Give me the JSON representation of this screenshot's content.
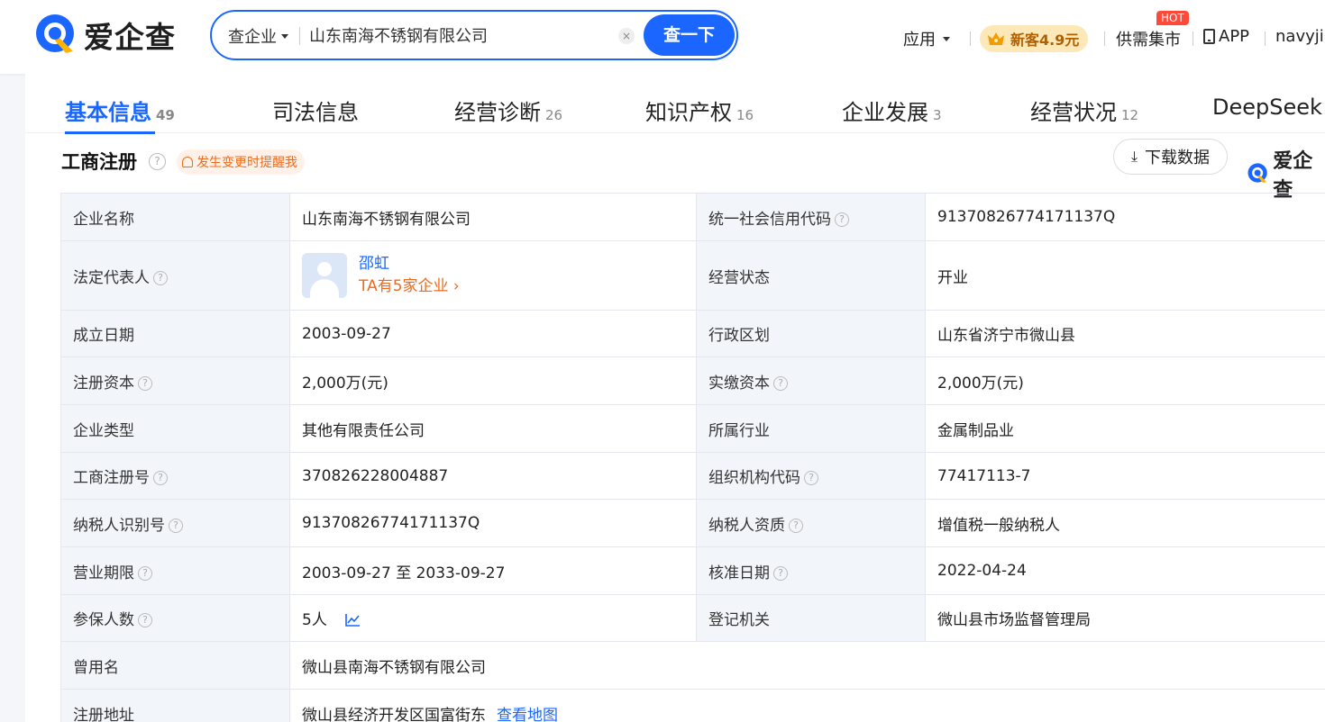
{
  "header": {
    "logo_text": "爱企查",
    "search_type": "查企业",
    "search_value": "山东南海不锈钢有限公司",
    "clear_label": "×",
    "search_button": "查一下",
    "apps_label": "应用",
    "promo_label": "新客4.9元",
    "market_label": "供需集市",
    "hot_badge": "HOT",
    "app_label": "APP",
    "user_label": "navyjia"
  },
  "tabs": [
    {
      "label": "基本信息",
      "count": "49",
      "active": true
    },
    {
      "label": "司法信息",
      "count": ""
    },
    {
      "label": "经营诊断",
      "count": "26"
    },
    {
      "label": "知识产权",
      "count": "16"
    },
    {
      "label": "企业发展",
      "count": "3"
    },
    {
      "label": "经营状况",
      "count": "12"
    },
    {
      "label": "DeepSeek",
      "count": ""
    }
  ],
  "section": {
    "title": "工商注册",
    "help": "?",
    "remind_label": "发生变更时提醒我",
    "download_label": "下载数据",
    "logo_text": "爱企查"
  },
  "table": {
    "company_name_label": "企业名称",
    "company_name": "山东南海不锈钢有限公司",
    "credit_code_label": "统一社会信用代码",
    "credit_code": "91370826774171137Q",
    "legal_rep_label": "法定代表人",
    "legal_rep_name": "邵虹",
    "legal_rep_link": "TA有5家企业 ›",
    "status_label": "经营状态",
    "status": "开业",
    "founded_label": "成立日期",
    "founded": "2003-09-27",
    "region_label": "行政区划",
    "region": "山东省济宁市微山县",
    "reg_capital_label": "注册资本",
    "reg_capital": "2,000万(元)",
    "paid_capital_label": "实缴资本",
    "paid_capital": "2,000万(元)",
    "type_label": "企业类型",
    "type": "其他有限责任公司",
    "industry_label": "所属行业",
    "industry": "金属制品业",
    "reg_no_label": "工商注册号",
    "reg_no": "370826228004887",
    "org_code_label": "组织机构代码",
    "org_code": "77417113-7",
    "tax_id_label": "纳税人识别号",
    "tax_id": "91370826774171137Q",
    "tax_qual_label": "纳税人资质",
    "tax_qual": "增值税一般纳税人",
    "term_label": "营业期限",
    "term": "2003-09-27 至 2033-09-27",
    "approved_label": "核准日期",
    "approved": "2022-04-24",
    "insured_label": "参保人数",
    "insured": "5人",
    "authority_label": "登记机关",
    "authority": "微山县市场监督管理局",
    "former_name_label": "曾用名",
    "former_name": "微山县南海不锈钢有限公司",
    "address_label": "注册地址",
    "address": "微山县经济开发区国富街东",
    "map_link": "查看地图"
  },
  "colors": {
    "brand_blue": "#1a66ff",
    "accent_orange": "#f06a1d",
    "label_bg": "#f2f6fb"
  }
}
